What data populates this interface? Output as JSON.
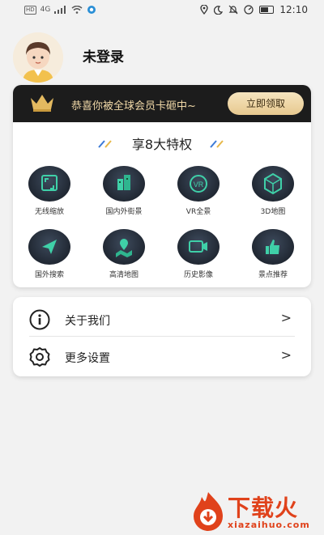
{
  "status_bar": {
    "network_badge": "HD",
    "network_type": "4G",
    "time": "12:10"
  },
  "profile": {
    "username": "未登录"
  },
  "vip": {
    "promo_text": "恭喜你被全球会员卡砸中~",
    "claim_button": "立即领取",
    "privileges_title": "享8大特权",
    "privileges": [
      {
        "label": "无线缩放",
        "icon": "zoom-icon"
      },
      {
        "label": "国内外街景",
        "icon": "street-view-icon"
      },
      {
        "label": "VR全景",
        "icon": "vr-icon"
      },
      {
        "label": "3D地图",
        "icon": "3d-map-icon"
      },
      {
        "label": "国外搜索",
        "icon": "location-arrow-icon"
      },
      {
        "label": "高清地图",
        "icon": "map-pin-icon"
      },
      {
        "label": "历史影像",
        "icon": "video-icon"
      },
      {
        "label": "景点推荐",
        "icon": "thumbs-up-icon"
      }
    ]
  },
  "menu": {
    "items": [
      {
        "label": "关于我们",
        "icon": "info-icon"
      },
      {
        "label": "更多设置",
        "icon": "settings-gear-icon"
      }
    ],
    "arrow": ">"
  },
  "watermark": {
    "brand": "下载火",
    "domain": "xiazaihuo.com"
  },
  "colors": {
    "accent_gold": "#e7c98f",
    "banner_dark": "#1c1c1c",
    "watermark_red": "#e0421b"
  }
}
